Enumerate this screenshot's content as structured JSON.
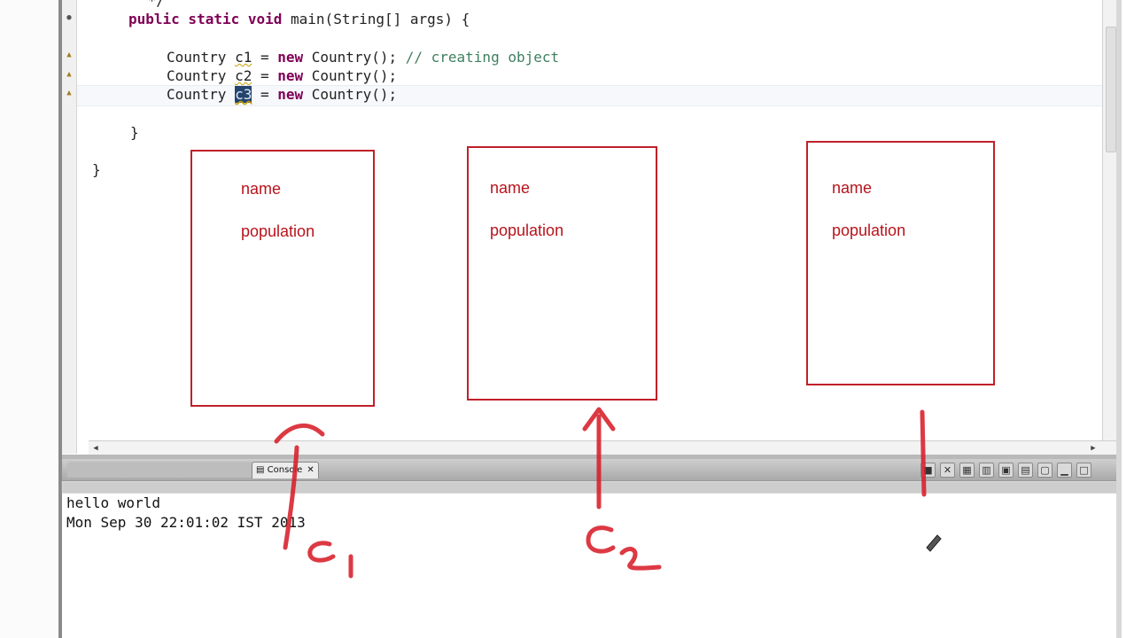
{
  "editor": {
    "code": {
      "comment_close": " */",
      "main_kw": "public static void",
      "main_rest": " main(String[] args) {",
      "line1_pre": "Country ",
      "line1_var": "c1",
      "line1_mid": " = ",
      "line1_kw": "new",
      "line1_post": " Country(); ",
      "line1_comment": "// creating object",
      "line2_pre": "Country ",
      "line2_var": "c2",
      "line2_mid": " = ",
      "line2_kw": "new",
      "line2_post": " Country();",
      "line3_pre": "Country ",
      "line3_var": "c3",
      "line3_mid": " = ",
      "line3_kw": "new",
      "line3_post": " Country();",
      "brace_method": "}",
      "brace_class": "}"
    }
  },
  "annotations": {
    "boxes": [
      {
        "field1": "name",
        "field2": "population"
      },
      {
        "field1": "name",
        "field2": "population"
      },
      {
        "field1": "name",
        "field2": "population"
      }
    ],
    "ink_color": "#c0202a"
  },
  "bottom_panel": {
    "active_tab": "Console",
    "active_tab_close": "✕",
    "console_lines": [
      "hello world",
      "Mon Sep 30 22:01:02 IST 2013"
    ]
  },
  "icons": {
    "tab_console_icon": "console-icon",
    "toolbar": [
      "terminate-icon",
      "remove-launch-icon",
      "clear-console-icon",
      "scroll-lock-icon",
      "pin-console-icon",
      "display-console-icon",
      "open-console-icon",
      "minimize-icon",
      "maximize-icon"
    ]
  }
}
